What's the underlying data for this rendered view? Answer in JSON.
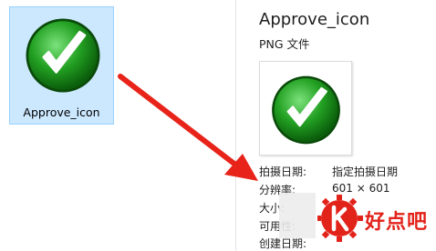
{
  "file_tile": {
    "label": "Approve_icon"
  },
  "details": {
    "title": "Approve_icon",
    "type": "PNG 文件",
    "properties": [
      {
        "label": "拍摄日期:",
        "value": "指定拍摄日期"
      },
      {
        "label": "分辨率:",
        "value": "601 × 601"
      },
      {
        "label": "大小:",
        "value": ""
      },
      {
        "label": "可用性:",
        "value": ""
      },
      {
        "label": "创建日期:",
        "value": ""
      }
    ]
  },
  "watermark": {
    "text": "好点吧"
  },
  "colors": {
    "selection": "#cce8ff",
    "arrow": "#e8231a",
    "icon_green": "#1f9a1f"
  },
  "icons": {
    "file_icon": "checkmark-icon",
    "preview_icon": "checkmark-icon",
    "watermark_logo": "k-gear-logo-icon"
  }
}
